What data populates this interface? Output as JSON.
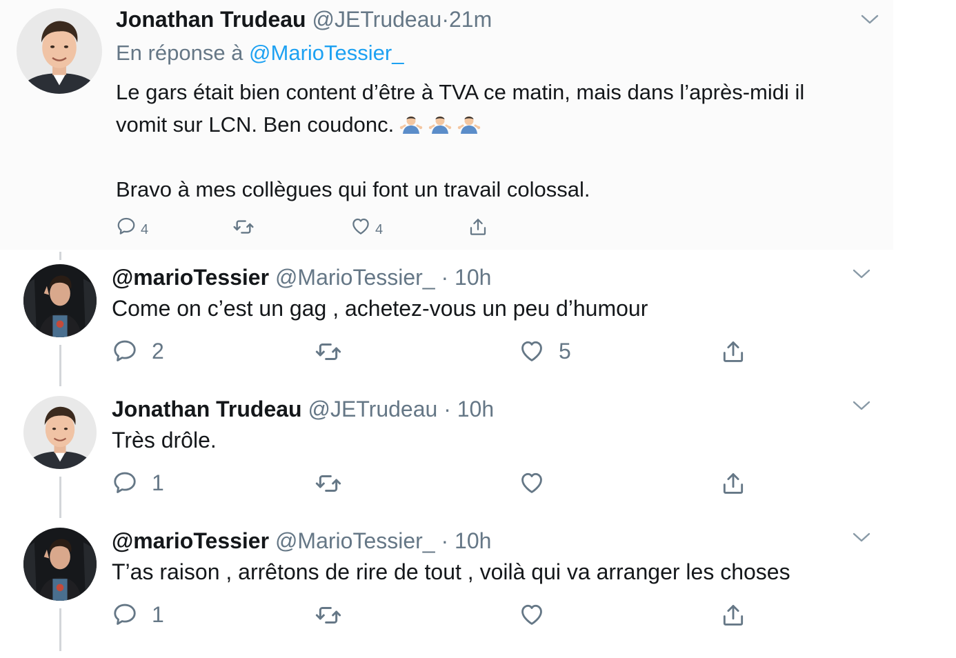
{
  "main_tweet": {
    "author_name": "Jonathan Trudeau",
    "handle": "@JETrudeau",
    "separator": "·",
    "time": "21m",
    "reply_prefix": "En réponse à",
    "reply_mention": "@MarioTessier_",
    "line1": "Le gars était bien content d’être à TVA ce matin, mais dans l’après-midi il",
    "line2": "vomit sur LCN. Ben coudonc.",
    "emoji": "shrug-emoji",
    "line3": "Bravo à mes collègues qui font un travail colossal.",
    "reply_count": "4",
    "like_count": "4"
  },
  "replies": [
    {
      "author_name": "@marioTessier",
      "handle": "@MarioTessier_",
      "separator": "·",
      "time": "10h",
      "text": "Come on c’est un gag , achetez-vous un peu d’humour",
      "reply_count": "2",
      "like_count": "5"
    },
    {
      "author_name": "Jonathan Trudeau",
      "handle": "@JETrudeau",
      "separator": "·",
      "time": "10h",
      "text": "Très drôle.",
      "reply_count": "1",
      "like_count": ""
    },
    {
      "author_name": "@marioTessier",
      "handle": "@MarioTessier_",
      "separator": "·",
      "time": "10h",
      "text": "T’as raison , arrêtons de rire de tout , voilà qui va arranger les choses",
      "reply_count": "1",
      "like_count": ""
    }
  ],
  "icons": [
    "reply-icon",
    "retweet-icon",
    "like-icon",
    "share-icon",
    "chevron-down-icon"
  ],
  "colors": {
    "text": "#14171a",
    "secondary": "#657786",
    "link": "#1da1f2"
  }
}
